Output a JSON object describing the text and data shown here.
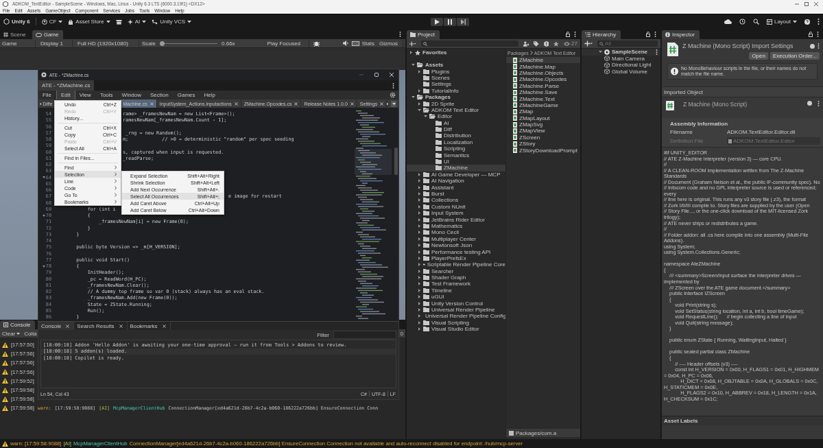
{
  "window": {
    "title": "ADKOM_TextEditor - SampleScene - Windows, Mac, Linux - Unity 6.3 LTS (6000.3.19f1) <DX12>"
  },
  "menu": [
    "File",
    "Edit",
    "Assets",
    "GameObject",
    "Component",
    "Services",
    "Jobs",
    "Tools",
    "Window",
    "Help"
  ],
  "toolbar": {
    "account": "Unity 6",
    "user": "CF",
    "asset_store": "Asset Store",
    "ai": "AI",
    "vcs": "Unity VCS",
    "layout": "Layout"
  },
  "view_tabs": [
    {
      "label": "Scene",
      "selected": false
    },
    {
      "label": "Game",
      "selected": true
    }
  ],
  "game_bar": {
    "mode": "Game",
    "display": "Display 1",
    "resolution": "Full HD (1920x1080)",
    "scale_label": "Scale",
    "scale": {
      "level": 0.02
    },
    "scale_value": "0.66x",
    "play_mode": "Play Focused",
    "stats": "Stats",
    "gizmos": "Gizmos"
  },
  "console": {
    "title": "Console",
    "clear": "Clear",
    "collapse": "Colla",
    "count": "0",
    "rows": [
      {
        "time": "[17:57:50]"
      },
      {
        "time": "[17:57:56]"
      },
      {
        "time": "[17:57:56]"
      },
      {
        "time": "[17:57:56]"
      },
      {
        "time": "[17:59:52]"
      },
      {
        "time": "[17:59:58]"
      },
      {
        "time": "[17:59:58]"
      },
      {
        "time": "[17:59:58]",
        "parts": [
          {
            "kind": "level",
            "text": "warn:"
          },
          {
            "kind": "text",
            "text": "[17:59:58:9088]"
          },
          {
            "kind": "tag",
            "text": "[AI]"
          },
          {
            "kind": "source",
            "text": "McpManagerClientHub"
          },
          {
            "kind": "text",
            "text": "ConnectionManager[ed4a621d-26b7-4c2a-b060-186222a726bb] EnsureConnection Conn"
          }
        ]
      }
    ]
  },
  "ate": {
    "title": "ATE - *ZMachine.cs",
    "tab": "ATE - *ZMachine.cs",
    "menu": [
      {
        "label": "File",
        "selected": false
      },
      {
        "label": "Edit",
        "selected": true
      },
      {
        "label": "View",
        "selected": false
      },
      {
        "label": "Tools",
        "selected": false
      },
      {
        "label": "Window",
        "selected": false
      },
      {
        "label": "Section",
        "selected": false
      },
      {
        "label": "Games",
        "selected": false
      },
      {
        "label": "Help",
        "selected": false
      }
    ],
    "doc_tabs": [
      {
        "label": "Diffe",
        "selected": false
      },
      {
        "label": "Machine.cs",
        "selected": true
      },
      {
        "label": "InputSystem_Actions.inputactions",
        "selected": false
      },
      {
        "label": "ZMachine.Opcodes.cs",
        "selected": false
      },
      {
        "label": "Release Notes 1.0.0",
        "selected": false
      },
      {
        "label": "Settings",
        "selected": false
      }
    ],
    "edit_menu": [
      {
        "kind": "item",
        "label": "Undo",
        "shortcut": "Ctrl+Z",
        "disabled": false
      },
      {
        "kind": "item",
        "label": "Redo",
        "shortcut": "Ctrl+Y",
        "disabled": true
      },
      {
        "kind": "item",
        "label": "History...",
        "disabled": false
      },
      {
        "kind": "separator"
      },
      {
        "kind": "item",
        "label": "Cut",
        "shortcut": "Ctrl+X",
        "disabled": false
      },
      {
        "kind": "item",
        "label": "Copy",
        "shortcut": "Ctrl+C",
        "disabled": false
      },
      {
        "kind": "item",
        "label": "Paste",
        "shortcut": "Ctrl+V",
        "disabled": true
      },
      {
        "kind": "item",
        "label": "Select All",
        "shortcut": "Ctrl+A",
        "disabled": false
      },
      {
        "kind": "separator"
      },
      {
        "kind": "item",
        "label": "Find in Files...",
        "disabled": false
      },
      {
        "kind": "separator"
      },
      {
        "kind": "submenu",
        "label": "Find",
        "selected": false
      },
      {
        "kind": "submenu",
        "label": "Selection",
        "selected": true
      },
      {
        "kind": "submenu",
        "label": "Line",
        "selected": false
      },
      {
        "kind": "submenu",
        "label": "Code",
        "selected": false
      },
      {
        "kind": "submenu",
        "label": "Go To",
        "selected": false
      },
      {
        "kind": "submenu",
        "label": "Bookmarks",
        "selected": false
      }
    ],
    "selection_menu": [
      {
        "label": "Expand Selection",
        "shortcut": "Shift+Alt+Right",
        "selected": false
      },
      {
        "label": "Shrink Selection",
        "shortcut": "Shift+Alt+Left",
        "selected": false
      },
      {
        "label": "Add Next Occurrence",
        "shortcut": "Shift+Alt+.",
        "selected": false
      },
      {
        "label": "Select All Occurrences",
        "shortcut": "Shift+Alt+;",
        "selected": true
      },
      {
        "label": "Add Caret Above",
        "shortcut": "Ctrl+Alt+Up",
        "selected": false
      },
      {
        "label": "Add Caret Below",
        "shortcut": "Ctrl+Alt+Down",
        "selected": false
      }
    ],
    "code": [
      {
        "num": "54",
        "fold": false,
        "kind": "after-menu",
        "text": "rame> _framesNewNam = new List<Frame>();"
      },
      {
        "num": "55",
        "fold": false,
        "kind": "after-menu",
        "text": "ramesNewNam[_framesNewNam.Count - 1];"
      },
      {
        "num": "56",
        "fold": false,
        "kind": "after-menu"
      },
      {
        "num": "57",
        "fold": false,
        "kind": "after-menu",
        "text": " _rng = new Random();"
      },
      {
        "num": "58",
        "fold": false,
        "kind": "after-menu",
        "text": "m;            // >0 → deterministic \"random\" per spec seeding"
      },
      {
        "num": "59",
        "fold": false,
        "kind": "after-menu"
      },
      {
        "num": "60",
        "fold": false,
        "kind": "after-menu",
        "text": "s, captured when input is requested."
      },
      {
        "num": "61",
        "fold": false,
        "kind": "after-menu",
        "text": "_readParse;"
      },
      {
        "num": "62",
        "fold": false,
        "kind": "after-menu"
      },
      {
        "num": "63",
        "fold": false,
        "kind": "after-menu"
      },
      {
        "num": "64",
        "fold": true,
        "kind": "after-menu"
      },
      {
        "num": "65",
        "fold": false,
        "kind": "after-menu"
      },
      {
        "num": "66",
        "fold": false,
        "kind": "after-menu"
      },
      {
        "num": "67",
        "fold": false,
        "kind": "after-submenu",
        "text": "e image for restart"
      },
      {
        "num": "68",
        "fold": false,
        "kind": "after-menu"
      },
      {
        "num": "69",
        "fold": false,
        "kind": "full",
        "text": "        for (int i"
      },
      {
        "num": "70",
        "fold": true,
        "kind": "full",
        "text": "        {"
      },
      {
        "num": "71",
        "fold": false,
        "kind": "full",
        "text": "            _framesNewNam[i] = new Frame(0);"
      },
      {
        "num": "72",
        "fold": false,
        "kind": "full",
        "text": "        }"
      },
      {
        "num": "73",
        "fold": false,
        "kind": "full",
        "text": "    }"
      },
      {
        "num": "74",
        "fold": false,
        "kind": "full"
      },
      {
        "num": "75",
        "fold": false,
        "kind": "full",
        "text": "    public byte Version => _m[H_VERSION];"
      },
      {
        "num": "76",
        "fold": false,
        "kind": "full"
      },
      {
        "num": "77",
        "fold": false,
        "kind": "full",
        "text": "    public void Start()"
      },
      {
        "num": "78",
        "fold": true,
        "kind": "full",
        "text": "    {"
      },
      {
        "num": "79",
        "fold": false,
        "kind": "full",
        "text": "        InitHeader();"
      },
      {
        "num": "80",
        "fold": false,
        "kind": "full",
        "text": "        _pc = ReadWord(H_PC);"
      },
      {
        "num": "81",
        "fold": false,
        "kind": "full",
        "text": "        _framesNewNam.Clear();"
      },
      {
        "num": "82",
        "fold": false,
        "kind": "full",
        "text": "        // A dummy top frame so var 0 (stack) always has an eval stack."
      },
      {
        "num": "83",
        "fold": false,
        "kind": "full",
        "text": "        _framesNewNam.Add(new Frame(0));"
      },
      {
        "num": "84",
        "fold": false,
        "kind": "full",
        "text": "        State = ZState.Running;"
      },
      {
        "num": "85",
        "fold": false,
        "kind": "full",
        "text": "        Run();"
      },
      {
        "num": "86",
        "fold": false,
        "kind": "full",
        "text": "    }"
      }
    ],
    "panel_tabs": [
      {
        "label": "Console",
        "selected": true
      },
      {
        "label": "Search Results",
        "selected": false
      },
      {
        "label": "Bookmarks",
        "selected": false
      }
    ],
    "filter_label": "Filter",
    "log": [
      "[18:00:18] Addon 'Hello Addon' is awaiting your one-time approval – run it from Tools > Addons to review.",
      "[18:00:18] 5 addon(s) loaded.",
      "[18:00:18] Copilot is ready."
    ],
    "position": "Ln 54, Col 43",
    "status": [
      "C#",
      "UTF-8",
      "LF"
    ]
  },
  "project": {
    "title": "Project",
    "count": "27",
    "favorites": {
      "label": "Favorites",
      "expanded": false
    },
    "tree": [
      {
        "label": "Assets",
        "expandable": true,
        "expanded": true,
        "selected": false,
        "children": [
          {
            "label": "Plugins",
            "expandable": true,
            "expanded": false,
            "selected": false
          },
          {
            "label": "Scenes",
            "expandable": false,
            "expanded": false,
            "selected": false
          },
          {
            "label": "Settings",
            "expandable": false,
            "expanded": false,
            "selected": false
          },
          {
            "label": "TutorialInfo",
            "expandable": true,
            "expanded": false,
            "selected": false
          }
        ]
      },
      {
        "label": "Packages",
        "expandable": true,
        "expanded": true,
        "selected": false,
        "children": [
          {
            "label": "2D Sprite",
            "expandable": true,
            "expanded": false,
            "selected": false
          },
          {
            "label": "ADKOM Text Editor",
            "expandable": true,
            "expanded": true,
            "selected": false,
            "children": [
              {
                "label": "Editor",
                "expandable": true,
                "expanded": true,
                "selected": false,
                "children": [
                  {
                    "label": "AI",
                    "expandable": false,
                    "expanded": false,
                    "selected": false
                  },
                  {
                    "label": "Diff",
                    "expandable": false,
                    "expanded": false,
                    "selected": false
                  },
                  {
                    "label": "Distribution",
                    "expandable": false,
                    "expanded": false,
                    "selected": false
                  },
                  {
                    "label": "Localization",
                    "expandable": false,
                    "expanded": false,
                    "selected": false
                  },
                  {
                    "label": "Scripting",
                    "expandable": false,
                    "expanded": false,
                    "selected": false
                  },
                  {
                    "label": "Semantics",
                    "expandable": false,
                    "expanded": false,
                    "selected": false
                  },
                  {
                    "label": "UI",
                    "expandable": false,
                    "expanded": false,
                    "selected": false
                  },
                  {
                    "label": "ZMachine",
                    "expandable": false,
                    "expanded": false,
                    "selected": true
                  }
                ]
              }
            ]
          },
          {
            "label": "AI Game Developer — MCP",
            "expandable": true,
            "expanded": false,
            "selected": false
          },
          {
            "label": "AI Navigation",
            "expandable": true,
            "expanded": false,
            "selected": false
          },
          {
            "label": "Assistant",
            "expandable": true,
            "expanded": false,
            "selected": false
          },
          {
            "label": "Burst",
            "expandable": true,
            "expanded": false,
            "selected": false
          },
          {
            "label": "Collections",
            "expandable": true,
            "expanded": false,
            "selected": false
          },
          {
            "label": "Custom NUnit",
            "expandable": true,
            "expanded": false,
            "selected": false
          },
          {
            "label": "Input System",
            "expandable": true,
            "expanded": false,
            "selected": false
          },
          {
            "label": "JetBrains Rider Editor",
            "expandable": true,
            "expanded": false,
            "selected": false
          },
          {
            "label": "Mathematics",
            "expandable": true,
            "expanded": false,
            "selected": false
          },
          {
            "label": "Mono Cecil",
            "expandable": true,
            "expanded": false,
            "selected": false
          },
          {
            "label": "Multiplayer Center",
            "expandable": true,
            "expanded": false,
            "selected": false
          },
          {
            "label": "Newtonsoft Json",
            "expandable": true,
            "expanded": false,
            "selected": false
          },
          {
            "label": "Performance testing API",
            "expandable": true,
            "expanded": false,
            "selected": false
          },
          {
            "label": "PlayerPrefsEx",
            "expandable": true,
            "expanded": false,
            "selected": false
          },
          {
            "label": "Scriptable Render Pipeline Core",
            "expandable": true,
            "expanded": false,
            "selected": false
          },
          {
            "label": "Searcher",
            "expandable": true,
            "expanded": false,
            "selected": false
          },
          {
            "label": "Shader Graph",
            "expandable": true,
            "expanded": false,
            "selected": false
          },
          {
            "label": "Test Framework",
            "expandable": true,
            "expanded": false,
            "selected": false
          },
          {
            "label": "Timeline",
            "expandable": true,
            "expanded": false,
            "selected": false
          },
          {
            "label": "uGUI",
            "expandable": true,
            "expanded": false,
            "selected": false
          },
          {
            "label": "Unity Version Control",
            "expandable": true,
            "expanded": false,
            "selected": false
          },
          {
            "label": "Universal Render Pipeline",
            "expandable": true,
            "expanded": false,
            "selected": false
          },
          {
            "label": "Universal Render Pipeline Config",
            "expandable": true,
            "expanded": false,
            "selected": false
          },
          {
            "label": "Visual Scripting",
            "expandable": true,
            "expanded": false,
            "selected": false
          },
          {
            "label": "Visual Studio Editor",
            "expandable": true,
            "expanded": false,
            "selected": false
          }
        ]
      }
    ],
    "breadcrumb": [
      "Packages",
      "ADKOM Text Editor"
    ],
    "files": [
      {
        "label": "ZMachine",
        "selected": true
      },
      {
        "label": "ZMachine.Map",
        "selected": false
      },
      {
        "label": "ZMachine.Objects",
        "selected": false
      },
      {
        "label": "ZMachine.Opcodes",
        "selected": false
      },
      {
        "label": "ZMachine.Parse",
        "selected": false
      },
      {
        "label": "ZMachine.Save",
        "selected": false
      },
      {
        "label": "ZMachine.Text",
        "selected": false
      },
      {
        "label": "ZMachineGame",
        "selected": false
      },
      {
        "label": "ZMap",
        "selected": false
      },
      {
        "label": "ZMapLayout",
        "selected": false
      },
      {
        "label": "ZMapSvg",
        "selected": false
      },
      {
        "label": "ZMapView",
        "selected": false
      },
      {
        "label": "ZScreen",
        "selected": false
      },
      {
        "label": "ZStory",
        "selected": false
      },
      {
        "label": "ZStoryDownloadPrompt",
        "selected": false
      }
    ],
    "path": "Packages/com.a"
  },
  "hierarchy": {
    "title": "Hierarchy",
    "search_placeholder": "All",
    "scene": {
      "label": "SampleScene",
      "expanded": true
    },
    "objects": [
      "Main Camera",
      "Directional Light",
      "Global Volume"
    ]
  },
  "inspector": {
    "title": "Inspector",
    "header": "Z Machine (Mono Script) Import Settings",
    "buttons": [
      "Open",
      "Execution Order..."
    ],
    "info": "No MonoBehaviour scripts in the file, or their names do not match the file name.",
    "imported_object": "Imported Object",
    "object_title": "Z Machine (Mono Script)",
    "assembly": {
      "heading": "Assembly Information",
      "fields": [
        {
          "label": "Filename",
          "value": "ADKOM.TextEditor.Editor.dll",
          "disabled": false
        },
        {
          "label": "Definition File",
          "value": "ADKOM.TextEditor.Editor",
          "disabled": true
        }
      ]
    },
    "source": [
      [
        "#if UNITY_EDITOR",
        "// ATE Z-Machine interpreter (version 3) — core CPU.",
        "//",
        "// A CLEAN-ROOM implementation written from The Z-Machine Standards",
        "// Document (Graham Nelson et al., the public IF-community spec). No",
        "// Infocom code and no GPL interpreter source is used or referenced; every",
        "// line here is original. This runs any v3 story file (.z3), the format",
        "// Zork I/II/III compile to. Story files are supplied by the user (Open",
        "// Story File..., or the one-click download of the MIT-licensed Zork trilogy);",
        "// ATE never ships or redistributes a game.",
        "//",
        "// Folder addon: all .cs here compile into one assembly (Multi-File Addons).",
        "using System;",
        "using System.Collections.Generic;"
      ],
      [
        "namespace AteZMachine",
        "{",
        "    /// <summary>Screen/input surface the interpreter drives — implemented by",
        "    /// ZScreen over the ATE game document.</summary>",
        "    public interface IZScreen",
        "    {",
        "        void Print(string s);",
        "        void SetStatus(string location, int a, int b, bool timeGame);",
        "        void RequestLine();      // begin collecting a line of input",
        "        void Quit(string message);",
        "    }"
      ],
      [
        "    public enum ZState { Running, WaitingInput, Halted }"
      ],
      [
        "    public sealed partial class ZMachine",
        "    {",
        "        // ---- Header offsets (v3) ----",
        "        const int H_VERSION = 0x00, H_FLAGS1 = 0x01, H_HIGHMEM = 0x04, H_PC = 0x06,",
        "            H_DICT = 0x08, H_OBJTABLE = 0x0A, H_GLOBALS = 0x0C, H_STATICMEM = 0x0E,",
        "            H_FLAGS2 = 0x10, H_ABBREV = 0x18, H_LENGTH = 0x1A, H_CHECKSUM = 0x1C;"
      ]
    ],
    "labels": "Asset Labels"
  },
  "status_bar": [
    {
      "kind": "level",
      "text": "warn: [17:59:58:9088]"
    },
    {
      "kind": "tag",
      "text": "[AI]"
    },
    {
      "kind": "source",
      "text": "McpManagerClientHub"
    },
    {
      "kind": "text",
      "text": "ConnectionManager[ed4a621d-26b7-4c2a-b060-186222a726bb] EnsureConnection Connection not available and auto-reconnect disabled for endpoint: /hub/mcp-server"
    }
  ]
}
